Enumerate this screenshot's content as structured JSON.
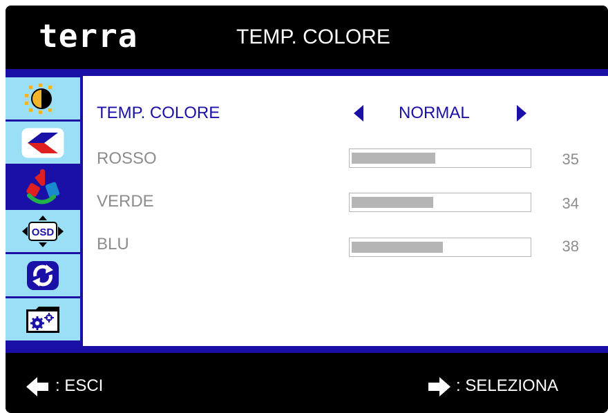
{
  "header": {
    "brand": "terra",
    "menu_title": "TEMP. COLORE"
  },
  "sidebar": {
    "items": [
      {
        "icon": "brightness-contrast-icon",
        "active": false
      },
      {
        "icon": "image-position-icon",
        "active": false
      },
      {
        "icon": "color-icon",
        "active": true
      },
      {
        "icon": "osd-icon",
        "active": false
      },
      {
        "icon": "reset-icon",
        "active": false
      },
      {
        "icon": "settings-icon",
        "active": false
      }
    ]
  },
  "settings": {
    "temp_colore": {
      "label": "TEMP. COLORE",
      "value": "NORMAL"
    },
    "rosso": {
      "label": "ROSSO",
      "value": "35"
    },
    "verde": {
      "label": "VERDE",
      "value": "34"
    },
    "blu": {
      "label": "BLU",
      "value": "38"
    }
  },
  "footer": {
    "back_label": ": ESCI",
    "select_label": ": SELEZIONA"
  },
  "colors": {
    "accent": "#1a10a8",
    "sidebar_item": "#9adff5",
    "text_inactive": "#8c8c8c",
    "bar_fill": "#b5b5b5",
    "frame": "#000000"
  }
}
